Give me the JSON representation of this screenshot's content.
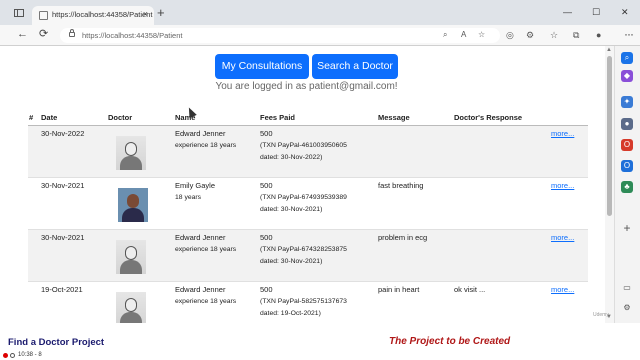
{
  "browser": {
    "tab_title": "https://localhost:44358/Patient",
    "tab_close": "×",
    "new_tab": "+",
    "min": "—",
    "max": "☐",
    "close": "✕",
    "back": "←",
    "reload": "⟳",
    "url_scheme": "https://localhost:44358/Patient",
    "menu": "···"
  },
  "page": {
    "button_consultations": "My Consultations",
    "button_search": "Search a Doctor",
    "logged_in_text": "You are logged in as patient@gmail.com!",
    "columns": [
      "#",
      "Date",
      "Doctor",
      "Name",
      "Fees Paid",
      "Message",
      "Doctor's Response"
    ],
    "rows": [
      {
        "date": "30-Nov-2022",
        "name": "Edward Jenner",
        "experience": "experience 18 years",
        "fee": "500",
        "txn": "(TXN PayPal-461003950605",
        "dated": "dated: 30-Nov-2022)",
        "message": "",
        "response": "",
        "more": "more..."
      },
      {
        "date": "30-Nov-2021",
        "name": "Emily Gayle",
        "experience": "18 years",
        "fee": "500",
        "txn": "(TXN PayPal-674939539389",
        "dated": "dated: 30-Nov-2021)",
        "message": "fast breathing",
        "response": "",
        "more": "more..."
      },
      {
        "date": "30-Nov-2021",
        "name": "Edward Jenner",
        "experience": "experience 18 years",
        "fee": "500",
        "txn": "(TXN PayPal-674328253875",
        "dated": "dated: 30-Nov-2021)",
        "message": "problem in ecg",
        "response": "",
        "more": "more..."
      },
      {
        "date": "19-Oct-2021",
        "name": "Edward Jenner",
        "experience": "experience 18 years",
        "fee": "500",
        "txn": "(TXN PayPal-582575137673",
        "dated": "dated: 19-Oct-2021)",
        "message": "pain in heart",
        "response": "ok visit ...",
        "more": "more..."
      }
    ]
  },
  "banner": {
    "left_title": "Find a Doctor Project",
    "time": "10:38 - 8",
    "right_title": "The Project to be Created",
    "watermark": "Udemy"
  },
  "colors": {
    "primary": "#0d6efd",
    "banner_left": "#1a1a6e",
    "banner_right": "#b01818"
  }
}
